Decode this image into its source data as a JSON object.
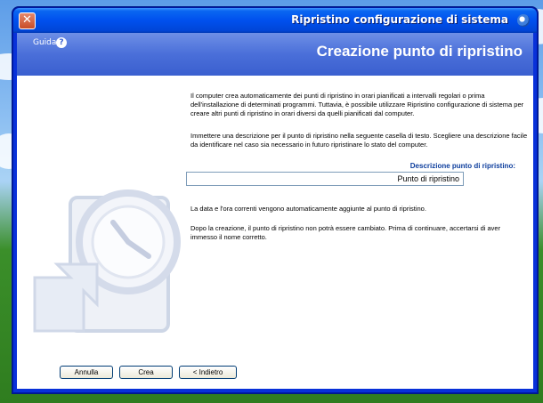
{
  "window": {
    "title": "Ripristino configurazione di sistema"
  },
  "header": {
    "title": "Creazione punto di ripristino",
    "help_label": "Guida"
  },
  "body": {
    "para1": "Il computer crea automaticamente dei punti di ripristino in orari pianificati a intervalli regolari o prima dell'installazione di determinati programmi. Tuttavia, è possibile utilizzare Ripristino configurazione di sistema per creare altri punti di ripristino in orari diversi da quelli pianificati dal computer.",
    "para2": "Immettere una descrizione per il punto di ripristino nella seguente casella di testo. Scegliere una descrizione facile da identificare nel caso sia necessario in futuro ripristinare lo stato del computer.",
    "field_label": "Descrizione punto di ripristino:",
    "field_value": "Punto di ripristino",
    "para3": "La data e l'ora correnti vengono automaticamente aggiunte al punto di ripristino.",
    "para4": "Dopo la creazione, il punto di ripristino non potrà essere cambiato. Prima di continuare, accertarsi di aver immesso il nome corretto."
  },
  "buttons": {
    "back": "< Indietro",
    "create": "Crea",
    "cancel": "Annulla"
  }
}
